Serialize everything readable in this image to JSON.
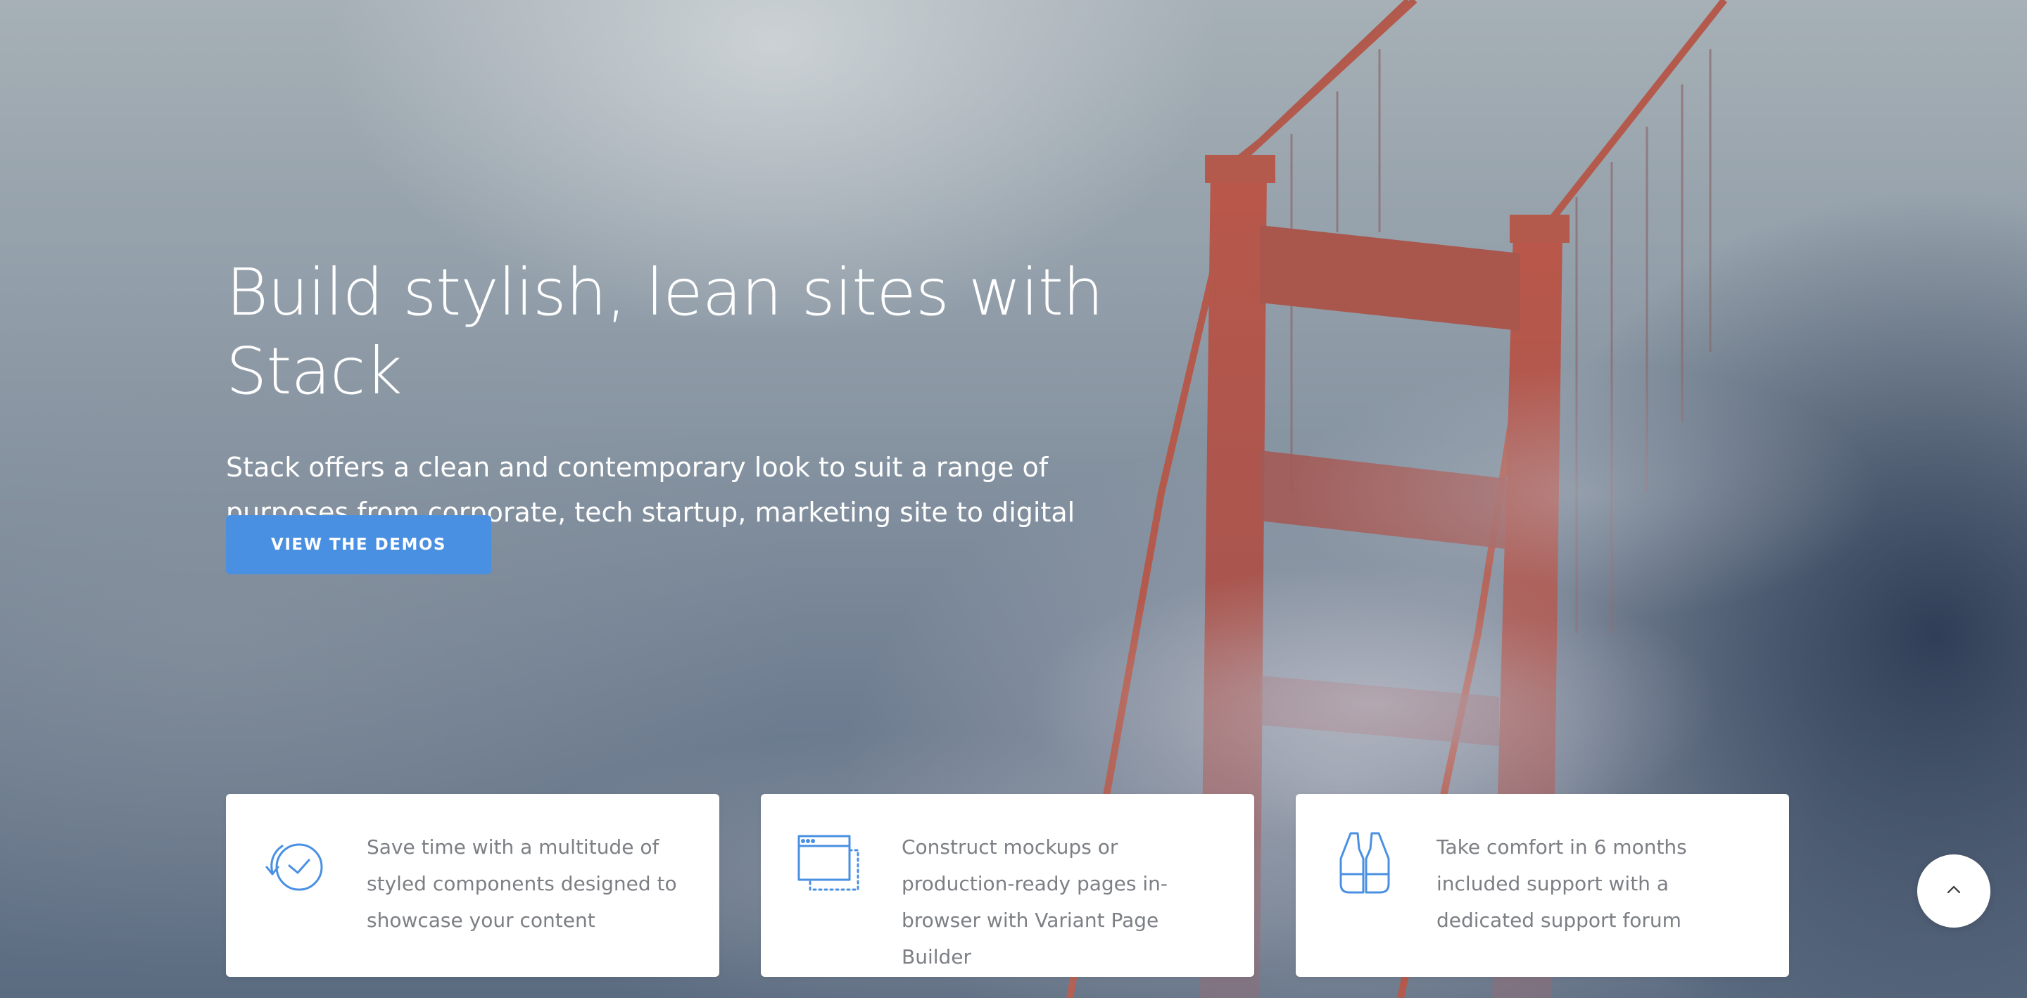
{
  "hero": {
    "headline": "Build stylish, lean sites with Stack",
    "lead": "Stack offers a clean and contemporary look to suit a range of purposes from corporate, tech startup, marketing site to digital storefront.",
    "cta_label": "VIEW THE DEMOS",
    "background_image": "golden-gate-bridge-in-fog"
  },
  "features": [
    {
      "icon": "clock-refresh-icon",
      "text": "Save time with a multitude of styled components designed to showcase your content"
    },
    {
      "icon": "browser-window-icon",
      "text": "Construct mockups or production-ready pages in-browser with Variant Page Builder"
    },
    {
      "icon": "life-vest-icon",
      "text": "Take comfort in 6 months included support with a dedicated support forum"
    }
  ],
  "scroll_top": {
    "icon": "chevron-up-icon"
  },
  "colors": {
    "accent": "#4a90e2",
    "card_text": "#7c7f84",
    "hero_text": "#ffffff"
  }
}
